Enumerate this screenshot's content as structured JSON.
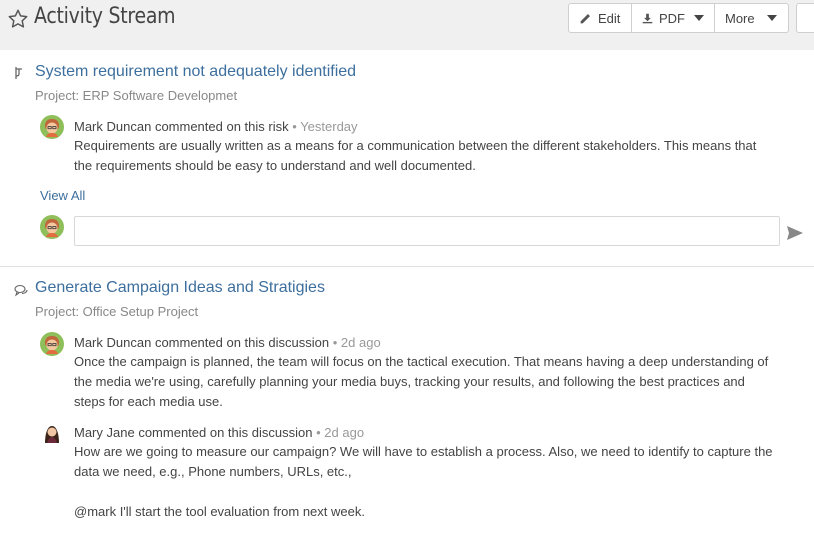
{
  "header": {
    "title": "Activity Stream",
    "buttons": {
      "edit": "Edit",
      "pdf": "PDF",
      "more": "More"
    }
  },
  "items": [
    {
      "type_icon": "risk-icon",
      "title": "System requirement not adequately identified",
      "project": "Project: ERP Software Developmet",
      "comments": [
        {
          "author": "Mark Duncan",
          "action": "commented on this risk",
          "time": "Yesterday",
          "lines": [
            "Requirements are usually written as a means for a communication between the different stakeholders. This means that",
            "the requirements should be easy to understand and well documented."
          ]
        }
      ],
      "view_all": "View All",
      "comment_input_placeholder": ""
    },
    {
      "type_icon": "discussion-icon",
      "title": "Generate Campaign Ideas and Stratigies",
      "project": "Project: Office Setup Project",
      "comments": [
        {
          "author": "Mark Duncan",
          "action": "commented on this discussion",
          "time": "2d ago",
          "lines": [
            "Once the campaign is planned, the team will focus on the tactical execution. That means having a deep understanding of",
            "the media we're using, carefully planning your media buys, tracking your results, and following the best practices and",
            "steps for each media use."
          ]
        },
        {
          "author": "Mary Jane",
          "action": "commented on this discussion",
          "time": "2d ago",
          "lines": [
            "How are we going to measure our campaign? We will have to establish a process. Also, we need to identify to capture the",
            "data we need, e.g., Phone numbers, URLs, etc.,",
            "",
            "@mark I'll start the tool evaluation from next week."
          ]
        }
      ]
    }
  ],
  "colors": {
    "link": "#3d6f9e",
    "meta": "#999999",
    "topbar": "#f0f0f0"
  }
}
